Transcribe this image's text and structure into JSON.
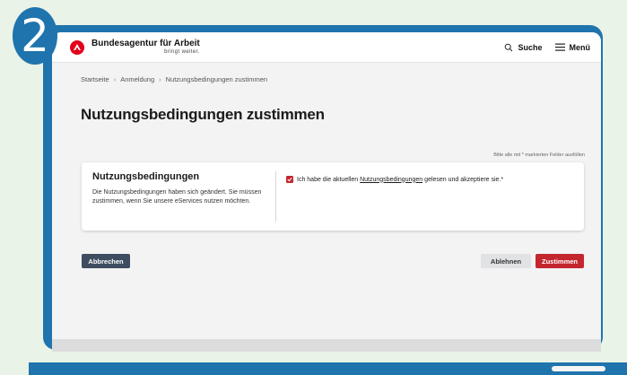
{
  "step_number": "2",
  "header": {
    "brand_name": "Bundesagentur für Arbeit",
    "brand_tagline": "bringt weiter.",
    "search_label": "Suche",
    "menu_label": "Menü"
  },
  "breadcrumb": [
    "Startseite",
    "Anmeldung",
    "Nutzungsbedingungen zustimmen"
  ],
  "page_title": "Nutzungsbedingungen zustimmen",
  "required_hint": "Bitte alle mit * markierten Felder ausfüllen",
  "terms_card": {
    "title": "Nutzungsbedingungen",
    "description": "Die Nutzungsbedingungen haben sich geändert. Sie müssen zustimmen, wenn Sie unsere eServices nutzen möchten.",
    "checkbox_checked": true,
    "checkbox_text_before": "Ich habe die aktuellen",
    "checkbox_link": "Nutzungsbedingungen",
    "checkbox_text_after": "gelesen und akzeptiere sie.*"
  },
  "buttons": {
    "cancel": "Abbrechen",
    "decline": "Ablehnen",
    "accept": "Zustimmen"
  },
  "colors": {
    "frame_blue": "#1f74ad",
    "brand_red": "#e2001a",
    "accept_red": "#c4262e",
    "cancel_dark": "#3e4d5f",
    "background_green": "#e9f3e7"
  }
}
